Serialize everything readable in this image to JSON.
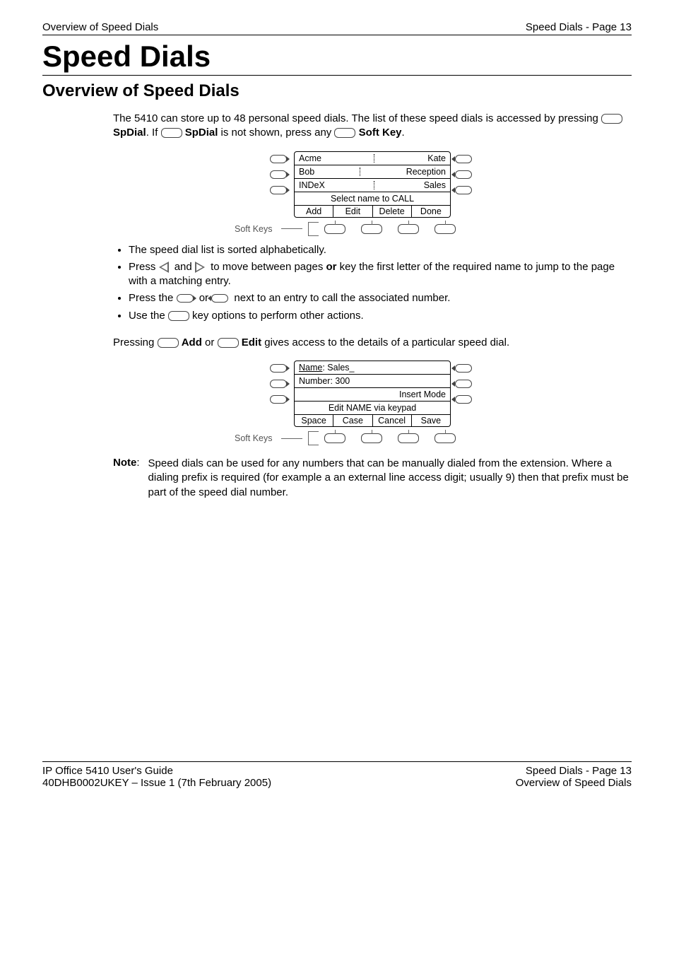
{
  "header": {
    "left": "Overview of Speed Dials",
    "right": "Speed Dials - Page 13"
  },
  "title": "Speed Dials",
  "subtitle": "Overview of Speed Dials",
  "intro": {
    "p1a": "The 5410 can store up to 48 personal speed dials. The list of these speed dials is accessed by pressing ",
    "sp1": "SpDial",
    "p1b": ". If ",
    "sp2": "SpDial",
    "p1c": " is not shown, press any ",
    "soft": "Soft Key",
    "p1d": "."
  },
  "fig1": {
    "rows": [
      {
        "left": "Acme",
        "right": "Kate"
      },
      {
        "left": "Bob",
        "right": "Reception"
      },
      {
        "left": "INDeX",
        "right": "Sales"
      }
    ],
    "prompt": "Select name to CALL",
    "softkeys": [
      "Add",
      "Edit",
      "Delete",
      "Done"
    ],
    "label": "Soft Keys"
  },
  "bullets": {
    "b1": "The speed dial list is sorted alphabetically.",
    "b2a": "Press ",
    "b2b": " and ",
    "b2c": " to move between pages ",
    "b2or": "or",
    "b2d": " key the first letter of the required name to jump to the page with a matching entry.",
    "b3a": "Press the ",
    "b3b": " or ",
    "b3c": " next to an entry to call the associated number.",
    "b4a": "Use the ",
    "b4b": " key options to perform other actions."
  },
  "pressingLine": {
    "a": "Pressing ",
    "add": "Add",
    "b": " or ",
    "edit": "Edit",
    "c": " gives access to the details of a particular speed dial."
  },
  "fig2": {
    "name_label": "Name",
    "name_value": ": Sales_",
    "number_row": "Number: 300",
    "mode_row": "Insert Mode",
    "prompt": "Edit NAME via keypad",
    "softkeys": [
      "Space",
      "Case",
      "Cancel",
      "Save"
    ],
    "label": "Soft Keys"
  },
  "note": {
    "label": "Note",
    "colon": ":",
    "body": "Speed dials can be used for any numbers that can be manually dialed from the extension. Where a dialing prefix is required (for example a an external line access digit; usually 9) then that prefix must be part of the speed dial number."
  },
  "footer": {
    "l1": "IP Office 5410 User's Guide",
    "l2": "40DHB0002UKEY – Issue 1 (7th February 2005)",
    "r1": "Speed Dials - Page 13",
    "r2": "Overview of Speed Dials"
  }
}
